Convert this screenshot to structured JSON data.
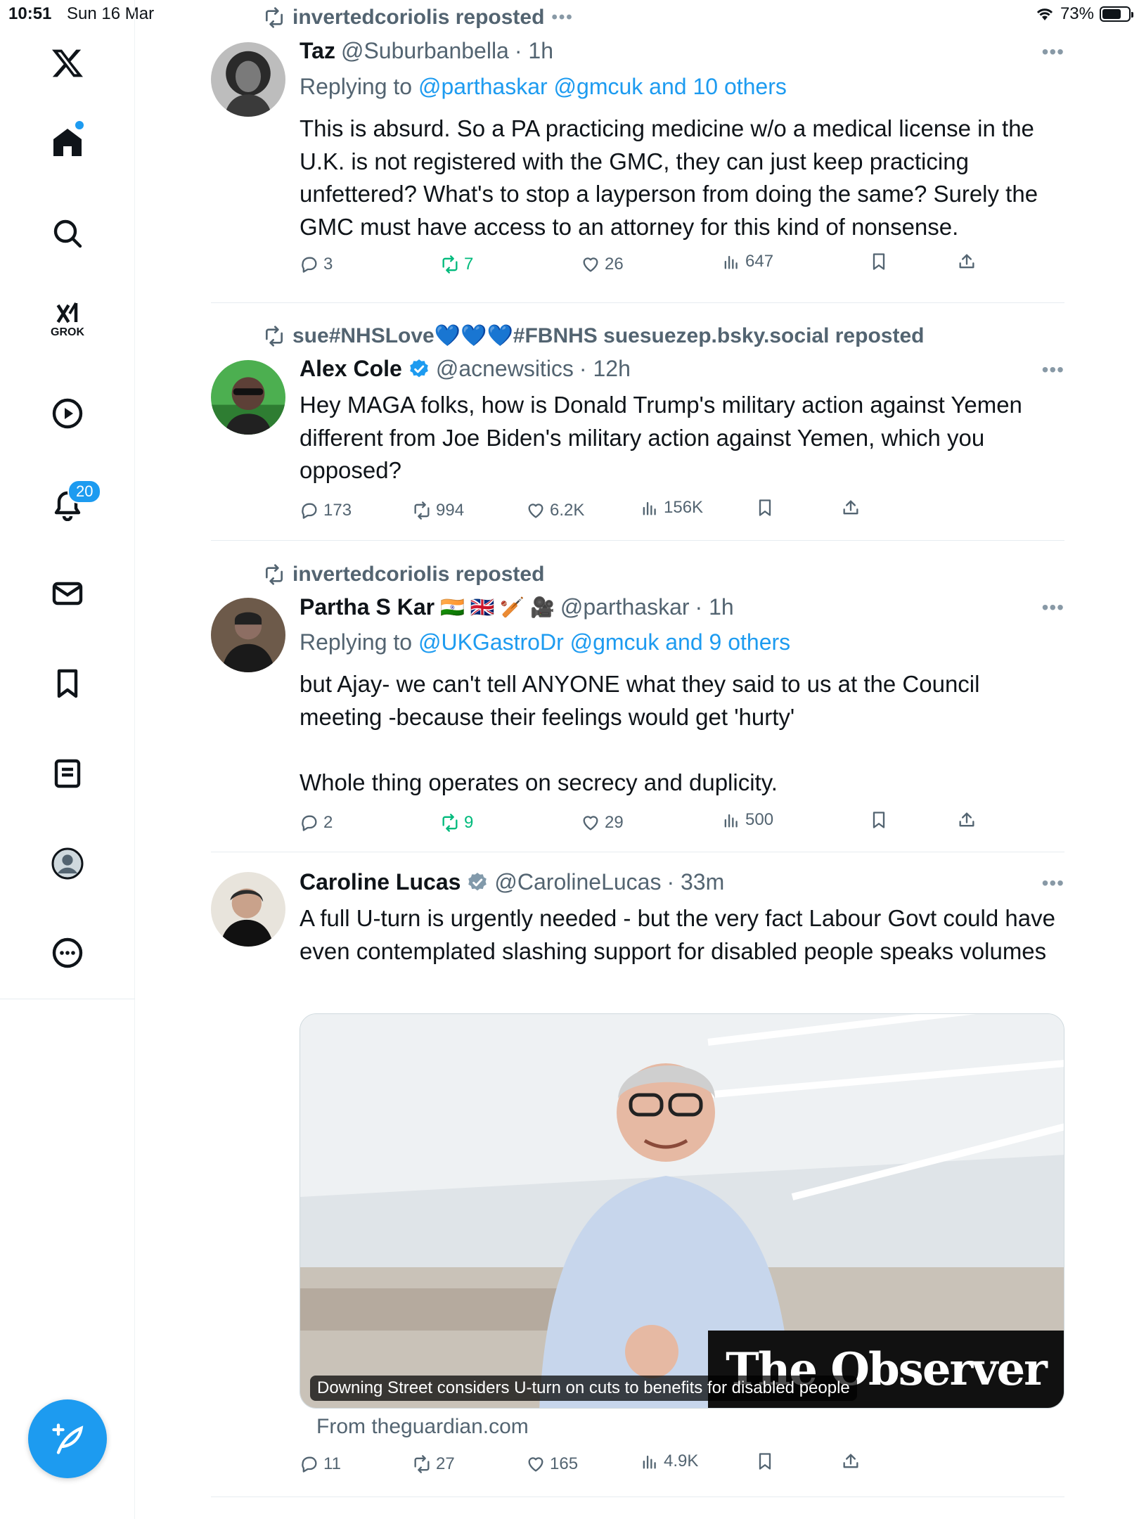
{
  "status_bar": {
    "time": "10:51",
    "date": "Sun 16 Mar",
    "battery": "73%",
    "battery_level": 0.73
  },
  "sidebar": {
    "items": [
      {
        "icon": "x-logo-icon"
      },
      {
        "icon": "home-icon",
        "has_dot": true
      },
      {
        "icon": "search-icon"
      },
      {
        "icon": "grok-icon",
        "label": "GROK"
      },
      {
        "icon": "video-play-icon"
      },
      {
        "icon": "notifications-bell-icon",
        "badge": "20"
      },
      {
        "icon": "messages-envelope-icon"
      },
      {
        "icon": "bookmarks-icon"
      },
      {
        "icon": "lists-icon"
      },
      {
        "icon": "profile-icon"
      },
      {
        "icon": "more-icon"
      }
    ],
    "compose_icon": "compose-feather-icon"
  },
  "colors": {
    "accent": "#1d9bf0",
    "text": "#0f1419",
    "muted": "#536471",
    "repost_green": "#00ba7c"
  },
  "tweets": [
    {
      "repost_label": "invertedcoriolis reposted",
      "name": "Taz",
      "handle": "@Suburbanbella",
      "time": "· 1h",
      "reply_prefix": "Replying to ",
      "reply_links": "@parthaskar @gmcuk and 10 others",
      "text": "This is absurd. So a PA practicing medicine w/o a medical license in the U.K. is not registered with the GMC, they can just keep practicing unfettered? What's to stop a layperson from doing the same? Surely the GMC must have access to an attorney for this kind of nonsense.",
      "replies": "3",
      "reposts": "7",
      "likes": "26",
      "views": "647"
    },
    {
      "repost_label": "sue#NHSLove💙💙💙#FBNHS suesuezep.bsky.social reposted",
      "name": "Alex Cole",
      "handle": "@acnewsitics",
      "time": "· 12h",
      "text": "Hey MAGA folks, how is Donald Trump's military action against Yemen different from Joe Biden's military action against Yemen, which you opposed?",
      "replies": "173",
      "reposts": "994",
      "likes": "6.2K",
      "views": "156K"
    },
    {
      "repost_label": "invertedcoriolis reposted",
      "name": "Partha S Kar",
      "name_emoji": "🇮🇳 🇬🇧 🏏 🎥",
      "handle": "@parthaskar",
      "time": "· 1h",
      "reply_prefix": "Replying to ",
      "reply_links": "@UKGastroDr @gmcuk and 9 others",
      "text": "but Ajay- we can't tell ANYONE what they said to us at the Council meeting -because their feelings would get 'hurty'\n\nWhole thing operates on secrecy and duplicity.",
      "replies": "2",
      "reposts": "9",
      "likes": "29",
      "views": "500"
    },
    {
      "name": "Caroline Lucas",
      "handle": "@CarolineLucas",
      "time": "· 33m",
      "text": "A full U-turn is urgently needed - but the very fact Labour Govt could have even contemplated slashing support for disabled people speaks volumes",
      "card_caption": "Downing Street considers U-turn on cuts to benefits for disabled people",
      "card_brand": "The Observer",
      "card_source": "From theguardian.com",
      "replies": "11",
      "reposts": "27",
      "likes": "165",
      "views": "4.9K"
    }
  ]
}
